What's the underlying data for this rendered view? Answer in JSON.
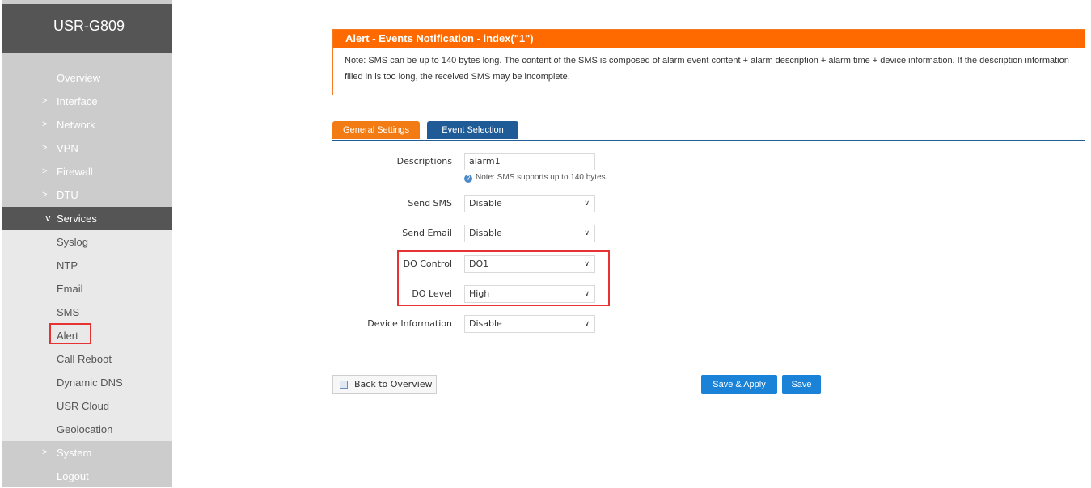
{
  "brand": "USR-G809",
  "sidebar": {
    "items": [
      {
        "label": "Overview",
        "chevron": ""
      },
      {
        "label": "Interface",
        "chevron": ">"
      },
      {
        "label": "Network",
        "chevron": ">"
      },
      {
        "label": "VPN",
        "chevron": ">"
      },
      {
        "label": "Firewall",
        "chevron": ">"
      },
      {
        "label": "DTU",
        "chevron": ">"
      },
      {
        "label": "Services",
        "chevron": "∨"
      },
      {
        "label": "Syslog",
        "chevron": ""
      },
      {
        "label": "NTP",
        "chevron": ""
      },
      {
        "label": "Email",
        "chevron": ""
      },
      {
        "label": "SMS",
        "chevron": ""
      },
      {
        "label": "Alert",
        "chevron": ""
      },
      {
        "label": "Call Reboot",
        "chevron": ""
      },
      {
        "label": "Dynamic DNS",
        "chevron": ""
      },
      {
        "label": "USR Cloud",
        "chevron": ""
      },
      {
        "label": "Geolocation",
        "chevron": ""
      },
      {
        "label": "System",
        "chevron": ">"
      },
      {
        "label": "Logout",
        "chevron": ""
      }
    ]
  },
  "notice": {
    "title": "Alert - Events Notification - index(\"1\")",
    "text": "Note: SMS can be up to 140 bytes long. The content of the SMS is composed of alarm event content + alarm description + alarm time + device information. If the description information filled in is too long, the received SMS may be incomplete."
  },
  "tabs": {
    "general": "General Settings",
    "event": "Event Selection"
  },
  "form": {
    "descriptions": {
      "label": "Descriptions",
      "value": "alarm1",
      "hint": "Note: SMS supports up to 140 bytes."
    },
    "send_sms": {
      "label": "Send SMS",
      "value": "Disable"
    },
    "send_email": {
      "label": "Send Email",
      "value": "Disable"
    },
    "do_control": {
      "label": "DO Control",
      "value": "DO1"
    },
    "do_level": {
      "label": "DO Level",
      "value": "High"
    },
    "device_info": {
      "label": "Device Information",
      "value": "Disable"
    }
  },
  "buttons": {
    "back": "Back to Overview",
    "save_apply": "Save & Apply",
    "save": "Save"
  },
  "colors": {
    "accent_orange": "#ff6a00",
    "tab_blue": "#1f5b97",
    "button_blue": "#1a83d8",
    "highlight_red": "#e53333",
    "sidebar_dark": "#555555"
  }
}
